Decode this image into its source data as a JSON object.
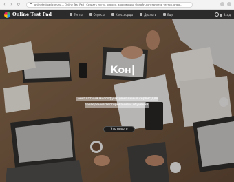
{
  "browser": {
    "url": "onlinetestpad.com/ru — Online Test Pad - Создать тесты, опросы, кроссворды, Онлайн-конструктор тестов, опро..."
  },
  "header": {
    "logo": "Online Test Pad",
    "menu": [
      {
        "label": "Тесты",
        "icon": "test-icon"
      },
      {
        "label": "Опросы",
        "icon": "survey-icon"
      },
      {
        "label": "Кроссворды",
        "icon": "crossword-icon"
      },
      {
        "label": "Диалоги",
        "icon": "dialog-icon"
      },
      {
        "label": "Еще",
        "icon": "more-icon"
      }
    ],
    "login": "Вход"
  },
  "hero": {
    "title": "Кон|",
    "subtitle": "Бесплатный многофункциональный сервис для проведения тестирования и обучения",
    "cta": "Что нового"
  },
  "colors": {
    "header_bg": "#2b2b2b",
    "accent": "#ffffff"
  }
}
